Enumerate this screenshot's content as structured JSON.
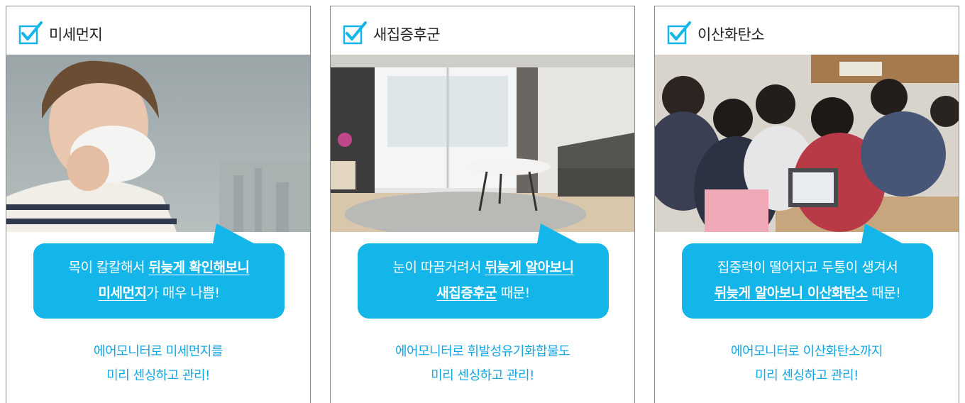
{
  "colors": {
    "accent": "#14b6ea",
    "note_text": "#14a5e4",
    "border": "#8a8a8a"
  },
  "cards": [
    {
      "title": "미세먼지",
      "icon": "checkbox-checked-icon",
      "photo": "child-wearing-mask-in-smog",
      "bubble": {
        "line1_plain": "목이 칼칼해서 ",
        "line1_bold": "뒤늦게 확인해보니",
        "line2_bold": "미세먼지",
        "line2_plain": "가 매우 나쁨!"
      },
      "note": {
        "line1": "에어모니터로 미세먼지를",
        "line2": "미리 센싱하고 관리!"
      }
    },
    {
      "title": "새집증후군",
      "icon": "checkbox-checked-icon",
      "photo": "new-apartment-living-room",
      "bubble": {
        "line1_plain": "눈이 따끔거려서 ",
        "line1_bold": "뒤늦게 알아보니",
        "line2_bold": "새집증후군",
        "line2_plain": " 때문!"
      },
      "note": {
        "line1": "에어모니터로 휘발성유기화합물도",
        "line2": "미리 센싱하고 관리!"
      }
    },
    {
      "title": "이산화탄소",
      "icon": "checkbox-checked-icon",
      "photo": "students-in-classroom",
      "bubble": {
        "line1_plain": "집중력이 떨어지고 두통이 생겨서",
        "line1_bold": "",
        "line2_bold": "뒤늦게 알아보니 이산화탄소",
        "line2_plain": " 때문!"
      },
      "note": {
        "line1": "에어모니터로 이산화탄소까지",
        "line2": "미리 센싱하고 관리!"
      }
    }
  ]
}
